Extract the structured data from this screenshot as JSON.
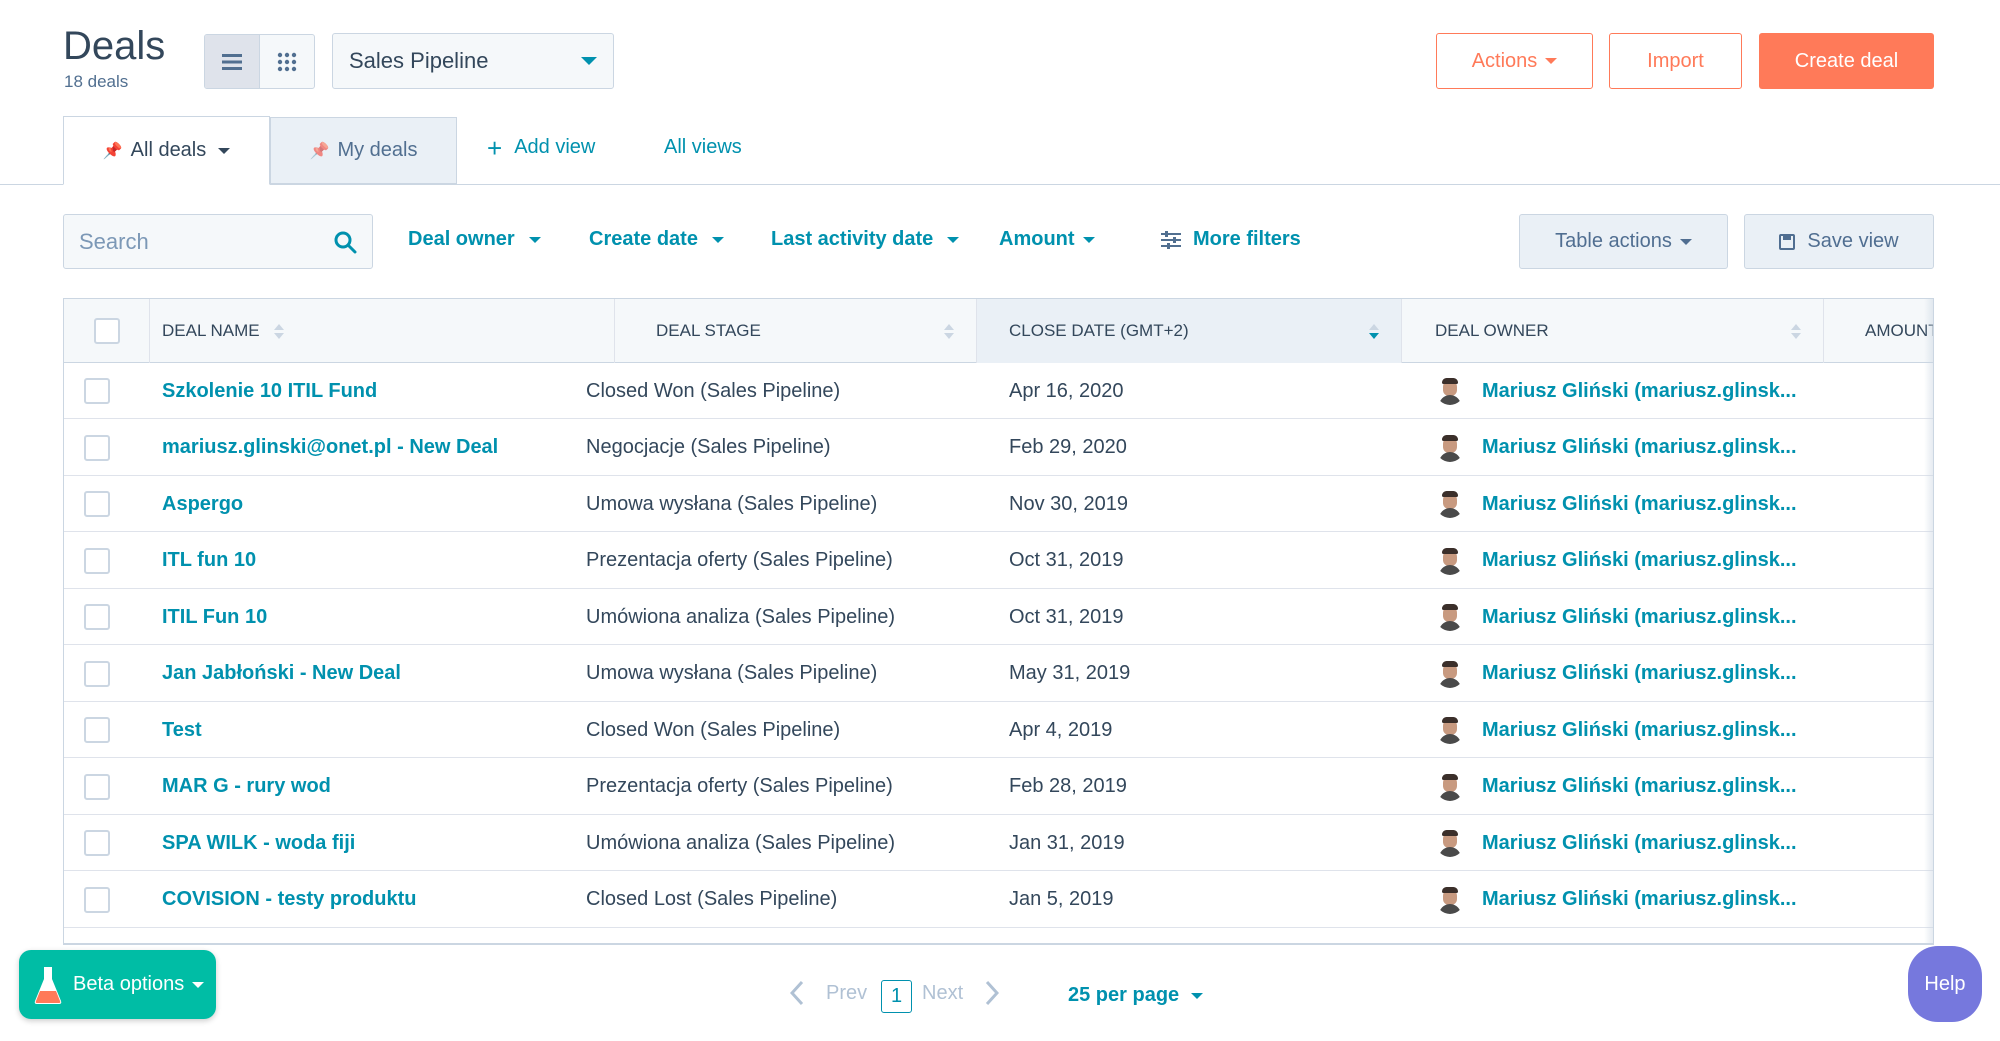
{
  "header": {
    "title": "Deals",
    "subtitle": "18 deals",
    "pipeline": "Sales Pipeline",
    "actions_label": "Actions",
    "import_label": "Import",
    "create_label": "Create deal"
  },
  "tabs": {
    "all_deals": "All deals",
    "my_deals": "My deals",
    "add_view": "Add view",
    "all_views": "All views"
  },
  "filters": {
    "search_placeholder": "Search",
    "deal_owner": "Deal owner",
    "create_date": "Create date",
    "last_activity": "Last activity date",
    "amount": "Amount",
    "more_filters": "More filters",
    "table_actions": "Table actions",
    "save_view": "Save view"
  },
  "table": {
    "columns": [
      "DEAL NAME",
      "DEAL STAGE",
      "CLOSE DATE (GMT+2)",
      "DEAL OWNER",
      "AMOUNT"
    ],
    "rows": [
      {
        "name": "Szkolenie 10 ITIL Fund",
        "stage": "Closed Won (Sales Pipeline)",
        "date": "Apr 16, 2020",
        "owner": "Mariusz Gliński (mariusz.glinsk..."
      },
      {
        "name": "mariusz.glinski@onet.pl - New Deal",
        "stage": "Negocjacje (Sales Pipeline)",
        "date": "Feb 29, 2020",
        "owner": "Mariusz Gliński (mariusz.glinsk..."
      },
      {
        "name": "Aspergo",
        "stage": "Umowa wysłana (Sales Pipeline)",
        "date": "Nov 30, 2019",
        "owner": "Mariusz Gliński (mariusz.glinsk..."
      },
      {
        "name": "ITL fun 10",
        "stage": "Prezentacja oferty (Sales Pipeline)",
        "date": "Oct 31, 2019",
        "owner": "Mariusz Gliński (mariusz.glinsk..."
      },
      {
        "name": "ITIL Fun 10",
        "stage": "Umówiona analiza (Sales Pipeline)",
        "date": "Oct 31, 2019",
        "owner": "Mariusz Gliński (mariusz.glinsk..."
      },
      {
        "name": "Jan Jabłoński - New Deal",
        "stage": "Umowa wysłana (Sales Pipeline)",
        "date": "May 31, 2019",
        "owner": "Mariusz Gliński (mariusz.glinsk..."
      },
      {
        "name": "Test",
        "stage": "Closed Won (Sales Pipeline)",
        "date": "Apr 4, 2019",
        "owner": "Mariusz Gliński (mariusz.glinsk..."
      },
      {
        "name": "MAR G - rury wod",
        "stage": "Prezentacja oferty (Sales Pipeline)",
        "date": "Feb 28, 2019",
        "owner": "Mariusz Gliński (mariusz.glinsk..."
      },
      {
        "name": "SPA WILK - woda fiji",
        "stage": "Umówiona analiza (Sales Pipeline)",
        "date": "Jan 31, 2019",
        "owner": "Mariusz Gliński (mariusz.glinsk..."
      },
      {
        "name": "COVISION - testy produktu",
        "stage": "Closed Lost (Sales Pipeline)",
        "date": "Jan 5, 2019",
        "owner": "Mariusz Gliński (mariusz.glinsk..."
      }
    ]
  },
  "pagination": {
    "prev": "Prev",
    "current": "1",
    "next": "Next",
    "per_page": "25 per page"
  },
  "widgets": {
    "beta": "Beta options",
    "help": "Help"
  },
  "colors": {
    "accent": "#ff7a59",
    "link": "#0091ae",
    "beta": "#00bda5",
    "help": "#7678dd"
  }
}
